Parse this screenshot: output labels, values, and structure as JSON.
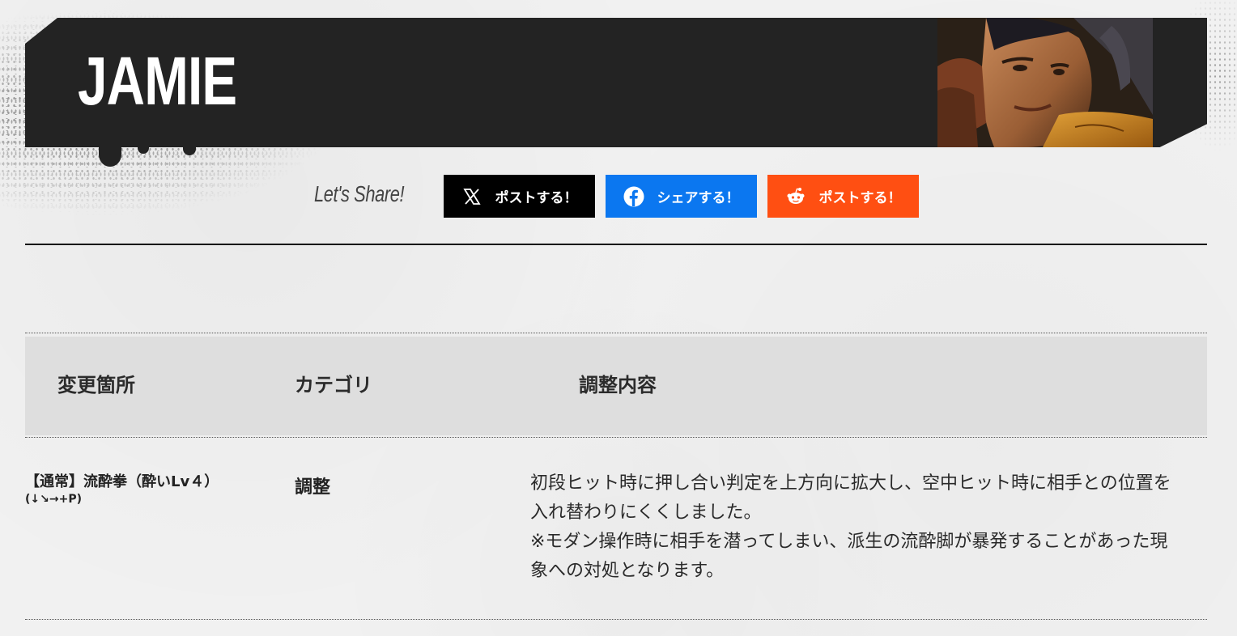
{
  "header": {
    "title": "JAMIE",
    "portrait_alt": "Jamie character portrait"
  },
  "share": {
    "label": "Let's Share!",
    "buttons": [
      {
        "label": "ポストする！",
        "icon": "x-logo-icon",
        "color": "#000000"
      },
      {
        "label": "シェアする！",
        "icon": "facebook-icon",
        "color": "#0b77f0"
      },
      {
        "label": "ポストする！",
        "icon": "reddit-icon",
        "color": "#ff4f12"
      }
    ]
  },
  "table": {
    "headers": [
      "変更箇所",
      "カテゴリ",
      "調整内容"
    ],
    "rows": [
      {
        "place": "【通常】流酔拳（酔いLv４）",
        "command": "(↓↘→+P)",
        "category": "調整",
        "description": [
          "初段ヒット時に押し合い判定を上方向に拡大し、空中ヒット時に相手との位置を入れ替わりにくくしました。",
          "※モダン操作時に相手を潜ってしまい、派生の流酔脚が暴発することがあった現象への対処となります。"
        ]
      }
    ]
  }
}
